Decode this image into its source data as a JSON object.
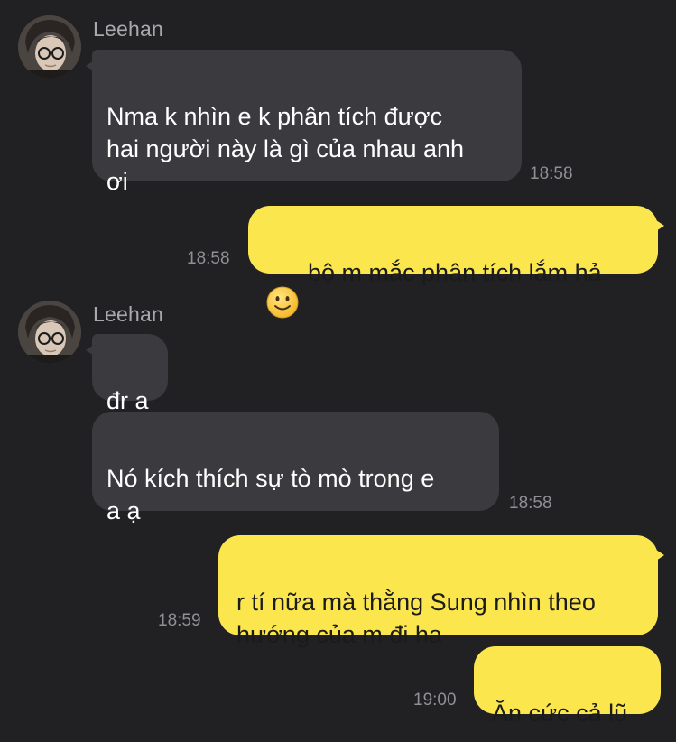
{
  "colors": {
    "background": "#212124",
    "incoming_bubble": "#3b3b3f",
    "outgoing_bubble": "#fbe74d",
    "timestamp": "#8f8f94",
    "sender_name": "#a9a9ad"
  },
  "messages": [
    {
      "from": "Leehan",
      "direction": "incoming",
      "text": "Nma k nhìn e k phân tích được\nhai người này là gì của nhau anh\nơi",
      "time": "18:58"
    },
    {
      "from": "me",
      "direction": "outgoing",
      "emoji": "slightly-smiling-face-icon",
      "text": "bộ m mắc phân tích lắm hả",
      "time": "18:58"
    },
    {
      "from": "Leehan",
      "direction": "incoming",
      "text": "đr a",
      "time": ""
    },
    {
      "from": "Leehan",
      "direction": "incoming",
      "text": "Nó kích thích sự tò mò trong e\na ạ",
      "time": "18:58"
    },
    {
      "from": "me",
      "direction": "outgoing",
      "text": "r tí nữa mà thằng Sung nhìn theo\nhướng của m đi ha",
      "time": "18:59"
    },
    {
      "from": "me",
      "direction": "outgoing",
      "text": "Ăn cức cả lũ",
      "time": "19:00"
    }
  ]
}
